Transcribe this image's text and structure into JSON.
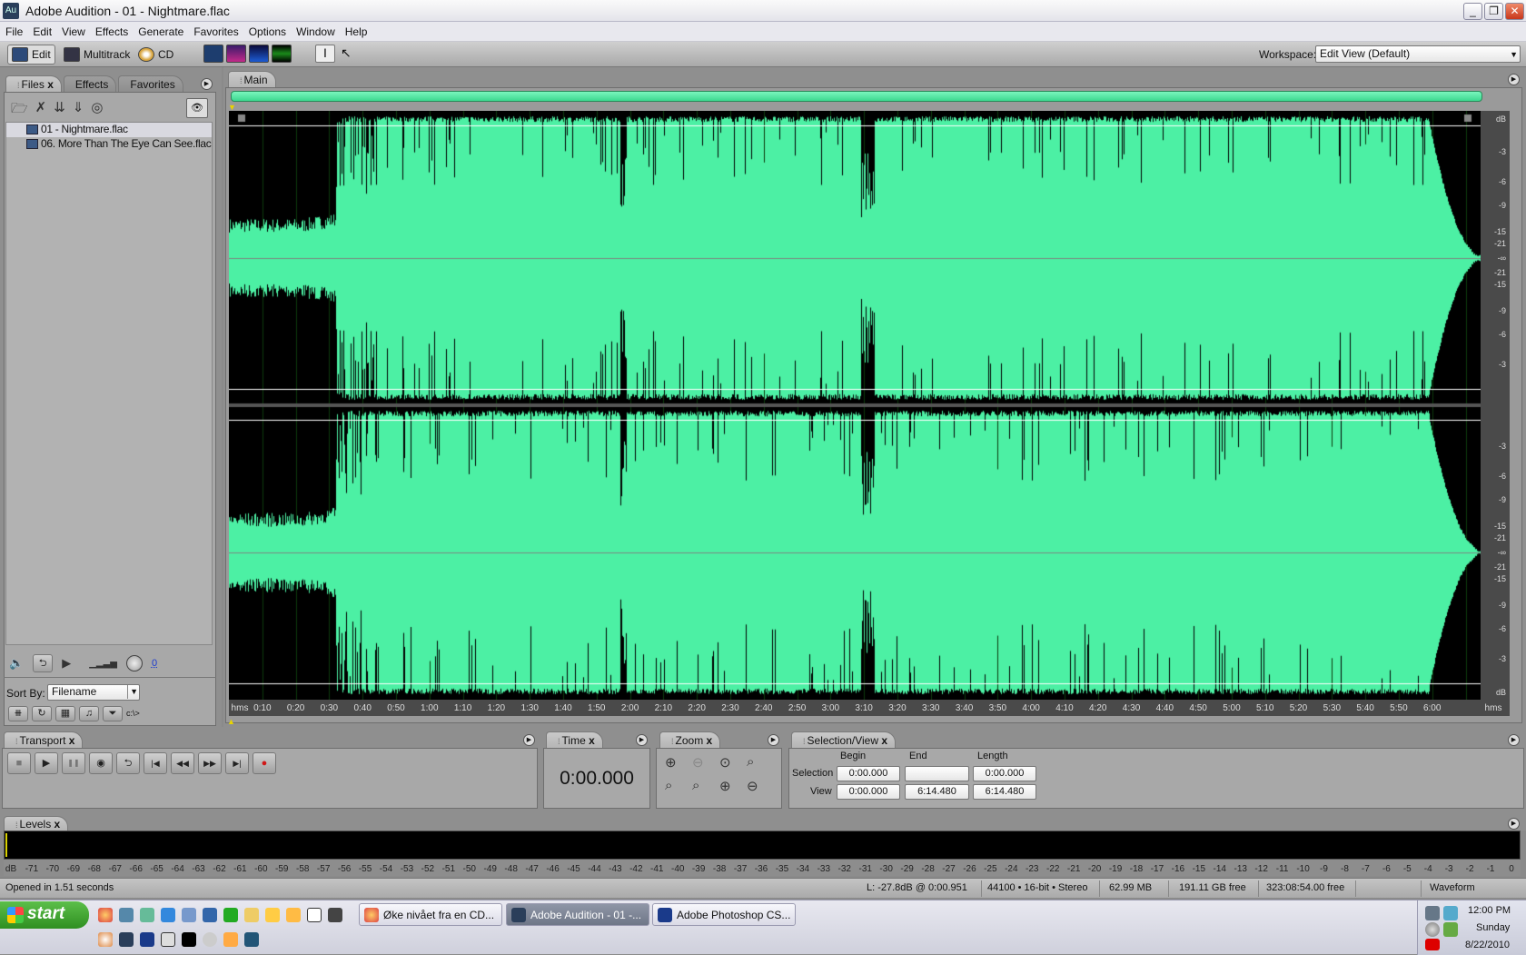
{
  "window": {
    "title": "Adobe Audition - 01 - Nightmare.flac",
    "app_icon": "Au",
    "minimize": "_",
    "restore": "❐",
    "close": "✕"
  },
  "menu": [
    "File",
    "Edit",
    "View",
    "Effects",
    "Generate",
    "Favorites",
    "Options",
    "Window",
    "Help"
  ],
  "toolbar": {
    "edit": "Edit",
    "multitrack": "Multitrack",
    "cd": "CD",
    "workspace_label": "Workspace:",
    "workspace_value": "Edit View (Default)"
  },
  "files_panel": {
    "tabs": [
      "Files",
      "Effects",
      "Favorites"
    ],
    "close": "x",
    "files": [
      "01 - Nightmare.flac",
      "06. More Than The Eye Can See.flac"
    ],
    "volume_value": "0",
    "sort_label": "Sort By:",
    "sort_value": "Filename"
  },
  "main": {
    "tab": "Main",
    "time_labels": [
      "hms",
      "0:10",
      "0:20",
      "0:30",
      "0:40",
      "0:50",
      "1:00",
      "1:10",
      "1:20",
      "1:30",
      "1:40",
      "1:50",
      "2:00",
      "2:10",
      "2:20",
      "2:30",
      "2:40",
      "2:50",
      "3:00",
      "3:10",
      "3:20",
      "3:30",
      "3:40",
      "3:50",
      "4:00",
      "4:10",
      "4:20",
      "4:30",
      "4:40",
      "4:50",
      "5:00",
      "5:10",
      "5:20",
      "5:30",
      "5:40",
      "5:50",
      "6:00",
      "hms"
    ],
    "duration_seconds": 374.48,
    "db_labels": [
      "dB",
      "-3",
      "-6",
      "-9",
      "-15",
      "-21",
      "-∞",
      "-21",
      "-15",
      "-9",
      "-6",
      "-3"
    ],
    "db_bottom": "dB",
    "waveform_color": "#4cf0a4"
  },
  "transport": {
    "tab": "Transport",
    "buttons": [
      "■",
      "▶",
      "❚❚",
      "◉",
      "⮌",
      "|◀",
      "◀◀",
      "▶▶",
      "▶|",
      "●"
    ]
  },
  "time": {
    "tab": "Time",
    "value": "0:00.000"
  },
  "zoom": {
    "tab": "Zoom"
  },
  "selection_view": {
    "tab": "Selection/View",
    "headers": [
      "Begin",
      "End",
      "Length"
    ],
    "rows": [
      {
        "label": "Selection",
        "begin": "0:00.000",
        "end": "",
        "length": "0:00.000"
      },
      {
        "label": "View",
        "begin": "0:00.000",
        "end": "6:14.480",
        "length": "6:14.480"
      }
    ]
  },
  "levels": {
    "tab": "Levels",
    "scale": [
      "dB",
      "-71",
      "-70",
      "-69",
      "-68",
      "-67",
      "-66",
      "-65",
      "-64",
      "-63",
      "-62",
      "-61",
      "-60",
      "-59",
      "-58",
      "-57",
      "-56",
      "-55",
      "-54",
      "-53",
      "-52",
      "-51",
      "-50",
      "-49",
      "-48",
      "-47",
      "-46",
      "-45",
      "-44",
      "-43",
      "-42",
      "-41",
      "-40",
      "-39",
      "-38",
      "-37",
      "-36",
      "-35",
      "-34",
      "-33",
      "-32",
      "-31",
      "-30",
      "-29",
      "-28",
      "-27",
      "-26",
      "-25",
      "-24",
      "-23",
      "-22",
      "-21",
      "-20",
      "-19",
      "-18",
      "-17",
      "-16",
      "-15",
      "-14",
      "-13",
      "-12",
      "-11",
      "-10",
      "-9",
      "-8",
      "-7",
      "-6",
      "-5",
      "-4",
      "-3",
      "-2",
      "-1",
      "0"
    ]
  },
  "status": {
    "message": "Opened in 1.51 seconds",
    "level": "L: -27.8dB @  0:00.951",
    "format": "44100 • 16-bit • Stereo",
    "size": "62.99 MB",
    "disk_free": "191.11 GB free",
    "time_free": "323:08:54.00 free",
    "view": "Waveform"
  },
  "taskbar": {
    "start": "start",
    "tasks": [
      "Øke nivået fra en CD...",
      "Adobe Audition - 01 -...",
      "Adobe Photoshop CS..."
    ],
    "clock": "12:00 PM",
    "day": "Sunday",
    "date": "8/22/2010"
  }
}
